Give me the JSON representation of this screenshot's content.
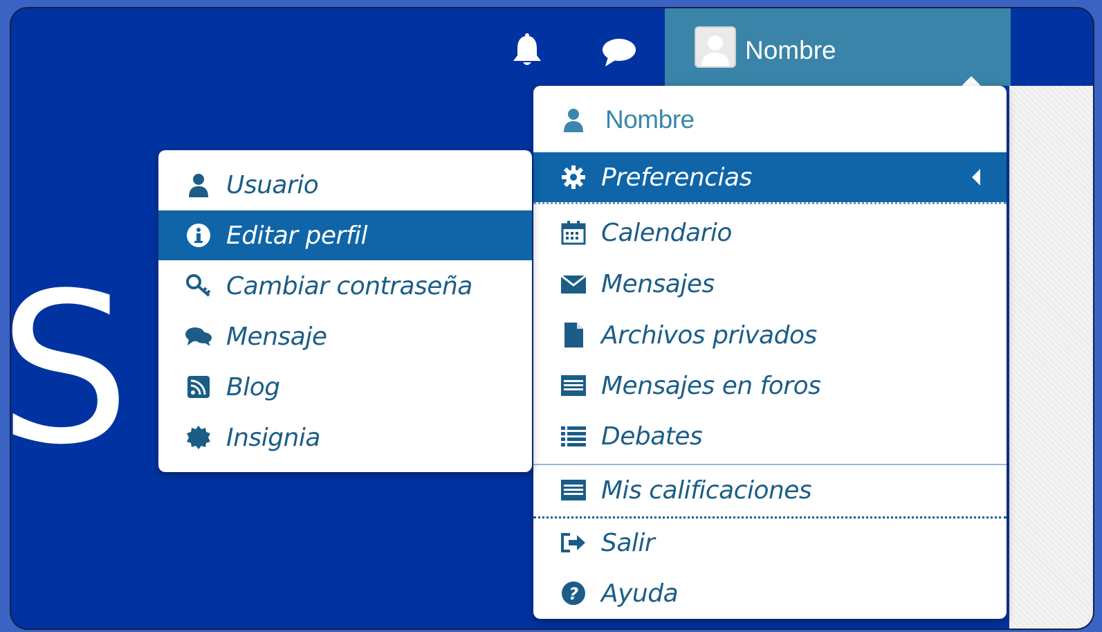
{
  "header": {
    "notification_icon": "bell-icon",
    "messages_icon": "chat-icon",
    "user_name": "Nombre"
  },
  "background": {
    "big_letter": "S"
  },
  "user_menu": {
    "header_label": "Nombre",
    "items": [
      {
        "label": "Preferencias",
        "icon": "gear-icon",
        "active": true
      },
      {
        "label": "Calendario",
        "icon": "calendar-icon"
      },
      {
        "label": "Mensajes",
        "icon": "envelope-icon"
      },
      {
        "label": "Archivos privados",
        "icon": "file-icon"
      },
      {
        "label": "Mensajes en foros",
        "icon": "list-box-icon"
      },
      {
        "label": "Debates",
        "icon": "list-icon"
      },
      {
        "label": "Mis calificaciones",
        "icon": "list-box-icon"
      },
      {
        "label": "Salir",
        "icon": "sign-out-icon"
      },
      {
        "label": "Ayuda",
        "icon": "question-icon"
      }
    ]
  },
  "preferences_submenu": {
    "items": [
      {
        "label": "Usuario",
        "icon": "user-icon"
      },
      {
        "label": "Editar perfil",
        "icon": "info-icon",
        "active": true
      },
      {
        "label": "Cambiar contraseña",
        "icon": "key-icon"
      },
      {
        "label": "Mensaje",
        "icon": "comments-icon"
      },
      {
        "label": "Blog",
        "icon": "rss-icon"
      },
      {
        "label": "Insignia",
        "icon": "badge-icon"
      }
    ]
  },
  "colors": {
    "page_background": "#0033a1",
    "outer_background": "#3a63c4",
    "user_tab": "#3984a8",
    "menu_text": "#1b5d87",
    "active_item": "#0f65a8"
  }
}
